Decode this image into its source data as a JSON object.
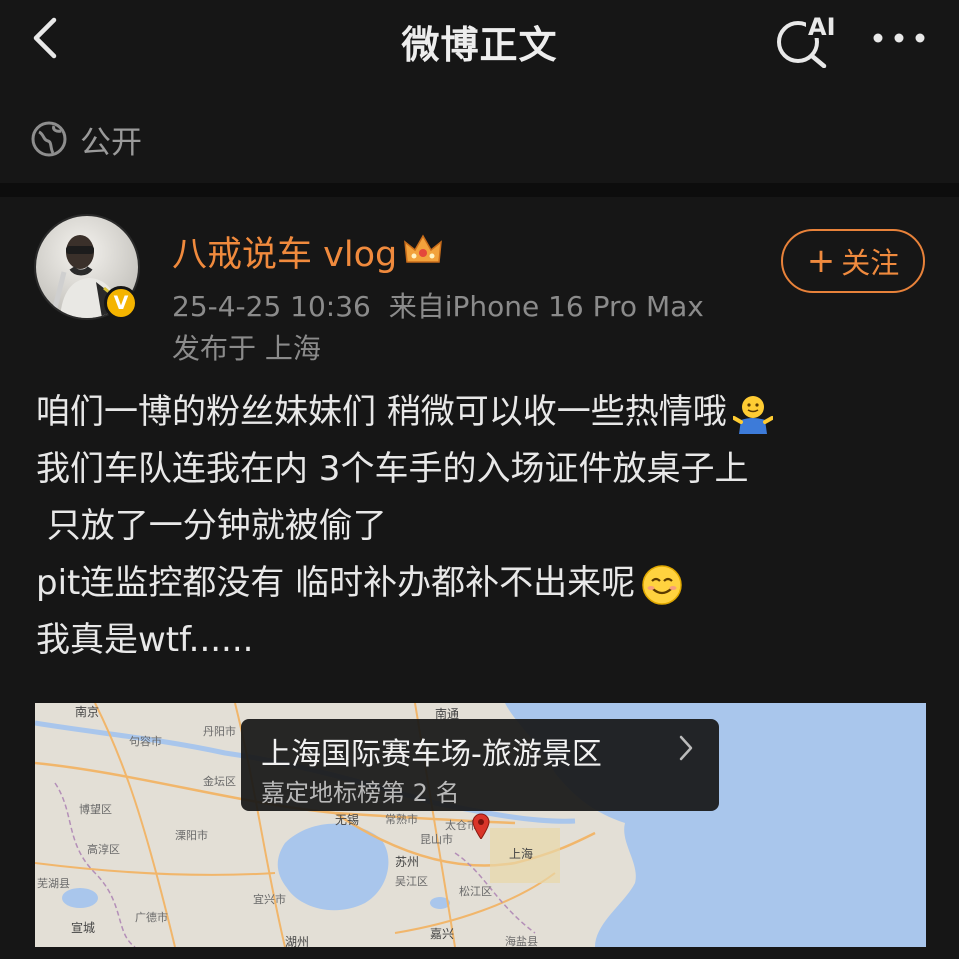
{
  "nav": {
    "title": "微博正文",
    "ai_badge": "AI"
  },
  "visibility": {
    "icon": "globe-icon",
    "label": "公开"
  },
  "post": {
    "author": "八戒说车 vlog",
    "follow_label": "关注",
    "timestamp": "25-4-25 10:36",
    "source": "来自iPhone 16 Pro Max",
    "location_prefix": "发布于 上海",
    "lines": [
      "咱们一博的粉丝妹妹们 稍微可以收一些热情哦",
      "我们车队连我在内 3个车手的入场证件放桌子上",
      " 只放了一分钟就被偷了",
      "pit连监控都没有 临时补办都补不出来呢",
      "我真是wtf......"
    ]
  },
  "location_card": {
    "title": "上海国际赛车场-旅游景区",
    "subtitle": "嘉定地标榜第 2 名",
    "map_labels": [
      "南京",
      "句容市",
      "丹阳市",
      "金坛区",
      "溧阳市",
      "博望区",
      "高淳区",
      "芜湖县",
      "宣城",
      "广德市",
      "湖州",
      "无锡",
      "常熟市",
      "苏州",
      "吴江区",
      "昆山市",
      "太仓市",
      "上海",
      "松江区",
      "嘉兴",
      "宜兴市",
      "海盐县",
      "南通"
    ]
  },
  "colors": {
    "background": "#161616",
    "accent_orange": "#f08a3d",
    "verified_gold": "#f4b400"
  }
}
